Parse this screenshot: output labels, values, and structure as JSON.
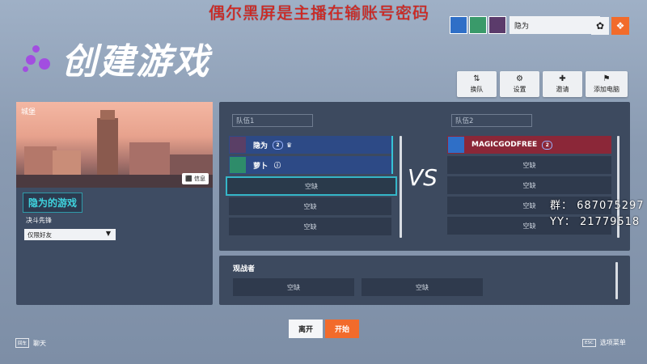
{
  "overlay_banner": "偶尔黑屏是主播在输账号密码",
  "page_title": "创建游戏",
  "player_bar": {
    "name": "隐为"
  },
  "action_buttons": [
    {
      "label": "换队",
      "icon": "swap-team-icon"
    },
    {
      "label": "设置",
      "icon": "settings-icon"
    },
    {
      "label": "邀请",
      "icon": "invite-icon"
    },
    {
      "label": "添加电脑",
      "icon": "add-ai-icon"
    }
  ],
  "map": {
    "name": "城堡",
    "info_label": "信息"
  },
  "game_name": "隐为的游戏",
  "mode": {
    "label": "决斗先锋",
    "selected": "仅限好友"
  },
  "team1": {
    "header": "队伍1",
    "slots": [
      {
        "type": "player",
        "name": "隐为",
        "level": "2",
        "badge": "crown"
      },
      {
        "type": "player",
        "name": "萝卜",
        "badge": "info"
      },
      {
        "type": "empty",
        "label": "空缺",
        "selected": true
      },
      {
        "type": "empty",
        "label": "空缺"
      },
      {
        "type": "empty",
        "label": "空缺"
      }
    ]
  },
  "vs_label": "VS",
  "team2": {
    "header": "队伍2",
    "slots": [
      {
        "type": "player",
        "name": "MAGICGODFREE",
        "level": "2"
      },
      {
        "type": "empty",
        "label": "空缺"
      },
      {
        "type": "empty",
        "label": "空缺"
      },
      {
        "type": "empty",
        "label": "空缺"
      },
      {
        "type": "empty",
        "label": "空缺"
      }
    ]
  },
  "spectators": {
    "label": "观战者",
    "slots": [
      "空缺",
      "空缺"
    ]
  },
  "buttons": {
    "leave": "离开",
    "start": "开始"
  },
  "footer": {
    "chat_key": "回车",
    "chat_label": "聊天",
    "menu_key": "ESC",
    "menu_label": "选项菜单"
  },
  "contact": {
    "group": "群：  687075297",
    "yy": "YY：  21779518"
  },
  "colors": {
    "accent": "#f26b2b",
    "team1": "#2d4a86",
    "team2": "#8b2738",
    "selection": "#35b6c8"
  }
}
